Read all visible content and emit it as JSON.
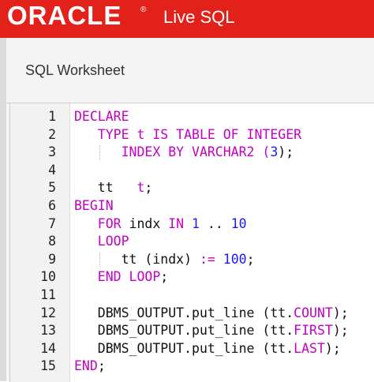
{
  "header": {
    "brand": "ORACLE",
    "registered_mark": "®",
    "product": "Live SQL"
  },
  "worksheet": {
    "title": "SQL Worksheet"
  },
  "code": {
    "line_numbers": [
      "1",
      "2",
      "3",
      "4",
      "5",
      "6",
      "7",
      "8",
      "9",
      "10",
      "11",
      "12",
      "13",
      "14",
      "15"
    ],
    "lines": [
      [
        {
          "t": "DECLARE",
          "c": "kw"
        }
      ],
      [
        {
          "t": "   TYPE t IS TABLE OF INTEGER",
          "c": "kw"
        }
      ],
      [
        {
          "t": "      INDEX BY VARCHAR2 (",
          "c": "kw"
        },
        {
          "t": "3",
          "c": "num"
        },
        {
          "t": ");",
          "c": "pl"
        }
      ],
      [],
      [
        {
          "t": "   tt   ",
          "c": "pl"
        },
        {
          "t": "t",
          "c": "kw"
        },
        {
          "t": ";",
          "c": "pl"
        }
      ],
      [
        {
          "t": "BEGIN",
          "c": "kw"
        }
      ],
      [
        {
          "t": "   FOR ",
          "c": "kw"
        },
        {
          "t": "indx ",
          "c": "pl"
        },
        {
          "t": "IN ",
          "c": "kw"
        },
        {
          "t": "1",
          "c": "num"
        },
        {
          "t": " .. ",
          "c": "pl"
        },
        {
          "t": "10",
          "c": "num"
        }
      ],
      [
        {
          "t": "   LOOP",
          "c": "kw"
        }
      ],
      [
        {
          "t": "      tt (indx) ",
          "c": "pl"
        },
        {
          "t": ":=",
          "c": "kw"
        },
        {
          "t": " ",
          "c": "pl"
        },
        {
          "t": "100",
          "c": "num"
        },
        {
          "t": ";",
          "c": "pl"
        }
      ],
      [
        {
          "t": "   END LOOP",
          "c": "kw"
        },
        {
          "t": ";",
          "c": "pl"
        }
      ],
      [],
      [
        {
          "t": "   DBMS_OUTPUT.put_line (tt.",
          "c": "pl"
        },
        {
          "t": "COUNT",
          "c": "kw"
        },
        {
          "t": ");",
          "c": "pl"
        }
      ],
      [
        {
          "t": "   DBMS_OUTPUT.put_line (tt.",
          "c": "pl"
        },
        {
          "t": "FIRST",
          "c": "kw"
        },
        {
          "t": ");",
          "c": "pl"
        }
      ],
      [
        {
          "t": "   DBMS_OUTPUT.put_line (tt.",
          "c": "pl"
        },
        {
          "t": "LAST",
          "c": "kw"
        },
        {
          "t": ");",
          "c": "pl"
        }
      ],
      [
        {
          "t": "END",
          "c": "kw"
        },
        {
          "t": ";",
          "c": "pl"
        }
      ]
    ]
  },
  "colors": {
    "header_bg": "#e3211b",
    "keyword": "#c400c4",
    "number": "#1a1aff"
  }
}
